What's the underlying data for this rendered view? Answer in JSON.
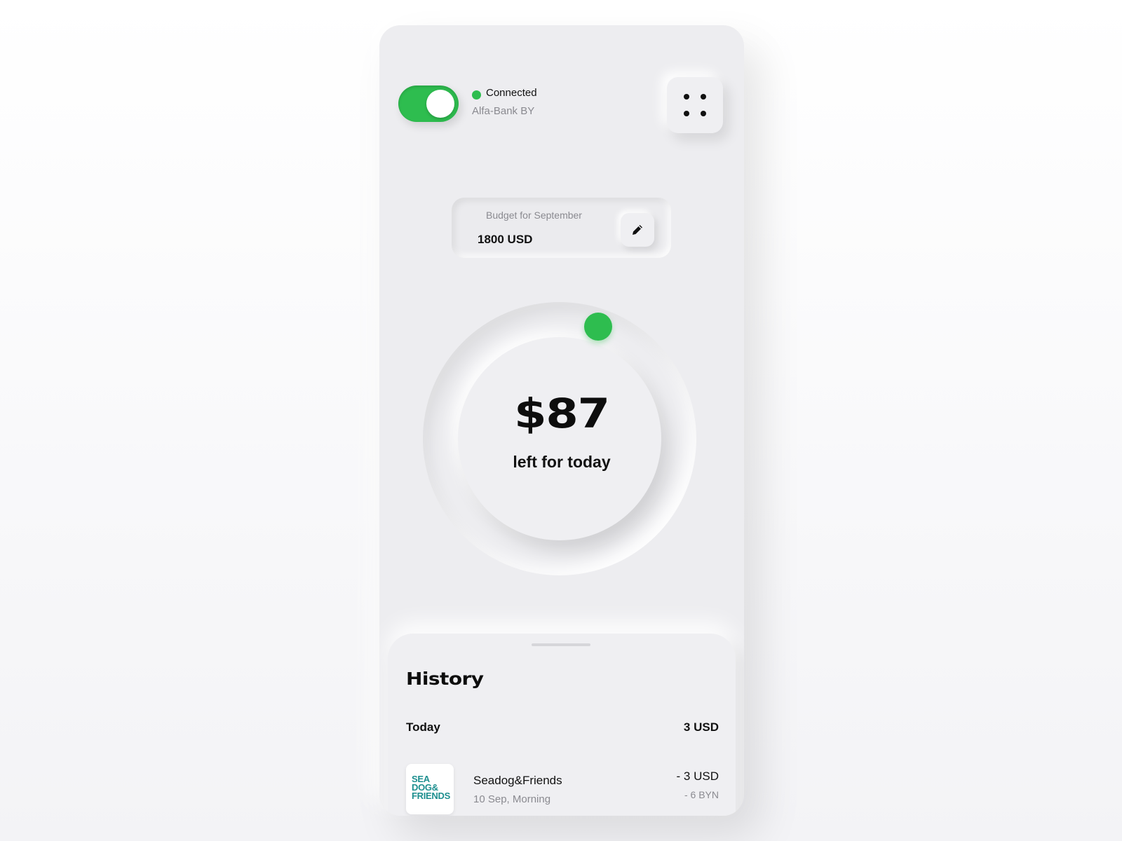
{
  "connection": {
    "status": "Connected",
    "bank": "Alfa-Bank BY",
    "toggle_on": true
  },
  "menu": {
    "icon": "four-dots-icon"
  },
  "budget": {
    "label": "Budget for September",
    "value": "1800 USD",
    "edit_icon": "pencil-icon"
  },
  "dial": {
    "amount": "$87",
    "caption": "left for today"
  },
  "history": {
    "title": "History",
    "groups": [
      {
        "label": "Today",
        "total": "3 USD",
        "transactions": [
          {
            "logo_lines": [
              "SEA",
              "DOG&",
              "FRIENDS"
            ],
            "name": "Seadog&Friends",
            "date": "10 Sep, Morning",
            "amount": "- 3 USD",
            "amount_alt": "- 6 BYN"
          }
        ]
      }
    ]
  },
  "colors": {
    "accent": "#2ebd4f",
    "background": "#ededf0",
    "logo_teal": "#1d8f8f"
  }
}
